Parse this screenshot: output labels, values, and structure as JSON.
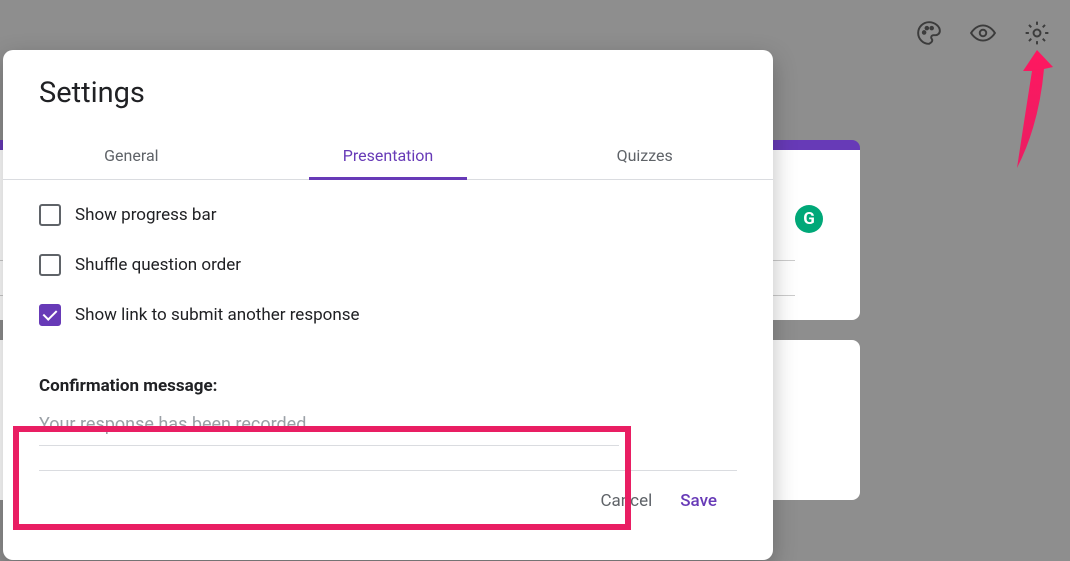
{
  "dialog": {
    "title": "Settings",
    "tabs": {
      "general": "General",
      "presentation": "Presentation",
      "quizzes": "Quizzes"
    },
    "options": {
      "progress_bar": "Show progress bar",
      "shuffle": "Shuffle question order",
      "submit_another": "Show link to submit another response"
    },
    "confirmation": {
      "label": "Confirmation message:",
      "placeholder": "Your response has been recorded."
    },
    "actions": {
      "cancel": "Cancel",
      "save": "Save"
    }
  },
  "background": {
    "badge": "G"
  },
  "colors": {
    "accent": "#673ab7",
    "highlight": "#e91e63",
    "badge_bg": "#00a878"
  }
}
